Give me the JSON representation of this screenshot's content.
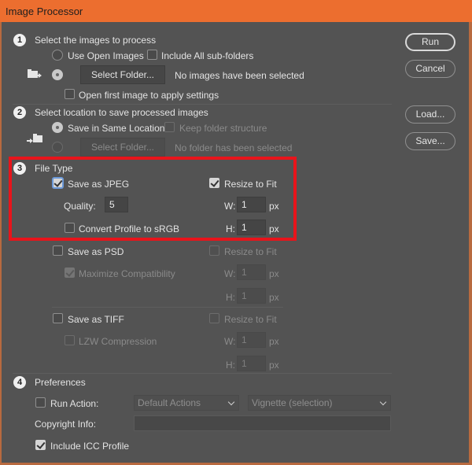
{
  "window": {
    "title": "Image Processor"
  },
  "actions": {
    "run": "Run",
    "cancel": "Cancel",
    "load": "Load...",
    "save": "Save..."
  },
  "section1": {
    "number": "1",
    "title": "Select the images to process",
    "use_open_images": "Use Open Images",
    "use_open_images_selected": false,
    "include_subfolders": "Include All sub-folders",
    "include_subfolders_checked": false,
    "folder_selected": true,
    "select_folder": "Select Folder...",
    "status": "No images have been selected",
    "open_first": "Open first image to apply settings",
    "open_first_checked": false
  },
  "section2": {
    "number": "2",
    "title": "Select location to save processed images",
    "save_same": "Save in Same Location",
    "save_same_selected": true,
    "keep_structure": "Keep folder structure",
    "keep_structure_checked": false,
    "select_folder": "Select Folder...",
    "status": "No folder has been selected"
  },
  "section3": {
    "number": "3",
    "title": "File Type",
    "jpeg": {
      "label": "Save as JPEG",
      "checked": true,
      "quality_label": "Quality:",
      "quality": "5",
      "convert_label": "Convert Profile to sRGB",
      "convert_checked": false,
      "resize_label": "Resize to Fit",
      "resize_checked": true,
      "w_label": "W:",
      "w": "1",
      "h_label": "H:",
      "h": "1",
      "unit": "px"
    },
    "psd": {
      "label": "Save as PSD",
      "checked": false,
      "maximize_label": "Maximize Compatibility",
      "maximize_checked": true,
      "resize_label": "Resize to Fit",
      "resize_checked": false,
      "w_label": "W:",
      "w": "1",
      "h_label": "H:",
      "h": "1",
      "unit": "px"
    },
    "tiff": {
      "label": "Save as TIFF",
      "checked": false,
      "lzw_label": "LZW Compression",
      "lzw_checked": false,
      "resize_label": "Resize to Fit",
      "resize_checked": false,
      "w_label": "W:",
      "w": "1",
      "h_label": "H:",
      "h": "1",
      "unit": "px"
    }
  },
  "section4": {
    "number": "4",
    "title": "Preferences",
    "run_action": "Run Action:",
    "run_action_checked": false,
    "action_set": "Default Actions",
    "action": "Vignette (selection)",
    "copyright_label": "Copyright Info:",
    "copyright_value": "",
    "icc": "Include ICC Profile",
    "icc_checked": true
  },
  "colors": {
    "titlebar": "#ec6e2f",
    "background": "#535353",
    "highlight_box": "#e8141b"
  }
}
